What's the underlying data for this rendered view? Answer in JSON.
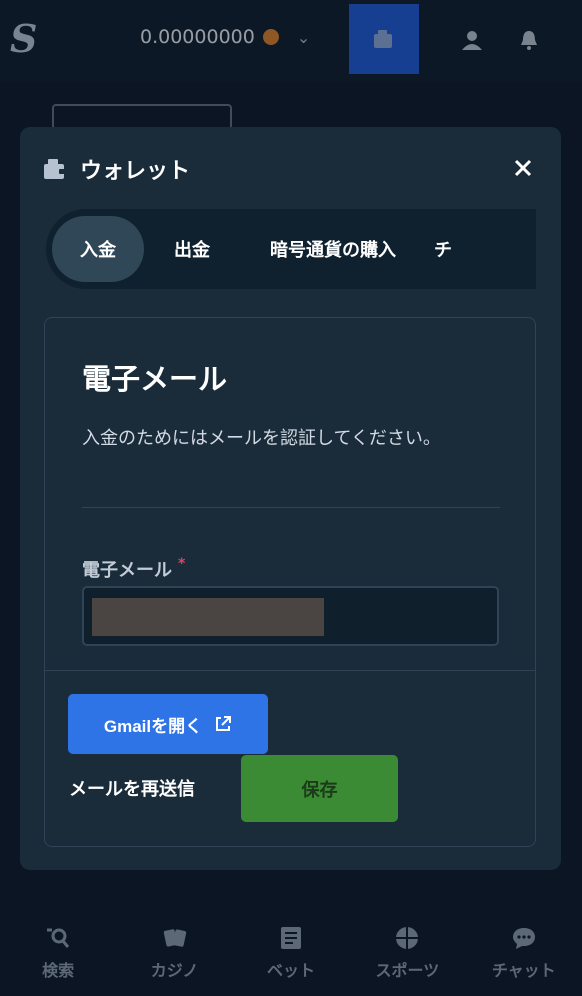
{
  "topbar": {
    "logo_text": "S",
    "balance": "0.00000000",
    "wallet_icon": "wallet-icon",
    "user_icon": "user-icon",
    "bell_icon": "bell-icon"
  },
  "modal": {
    "title": "ウォレット",
    "tabs": [
      {
        "label": "入金",
        "active": true
      },
      {
        "label": "出金",
        "active": false
      },
      {
        "label": "暗号通貨の購入",
        "active": false
      },
      {
        "label": "チ",
        "active": false
      }
    ],
    "section_title": "電子メール",
    "description": "入金のためにはメールを認証してください。",
    "email_label": "電子メール",
    "required_mark": "*",
    "gmail_button": "Gmailを開く",
    "resend_link": "メールを再送信",
    "save_button": "保存"
  },
  "bottom_nav": [
    {
      "label": "検索",
      "icon": "search-icon"
    },
    {
      "label": "カジノ",
      "icon": "cards-icon"
    },
    {
      "label": "ベット",
      "icon": "betslip-icon"
    },
    {
      "label": "スポーツ",
      "icon": "basketball-icon"
    },
    {
      "label": "チャット",
      "icon": "chat-icon"
    }
  ],
  "colors": {
    "background": "#0f1b2b",
    "modal": "#1a2c3a",
    "primary_blue": "#2f74e6",
    "save_green": "#3b8b34",
    "required_red": "#e0455d"
  }
}
